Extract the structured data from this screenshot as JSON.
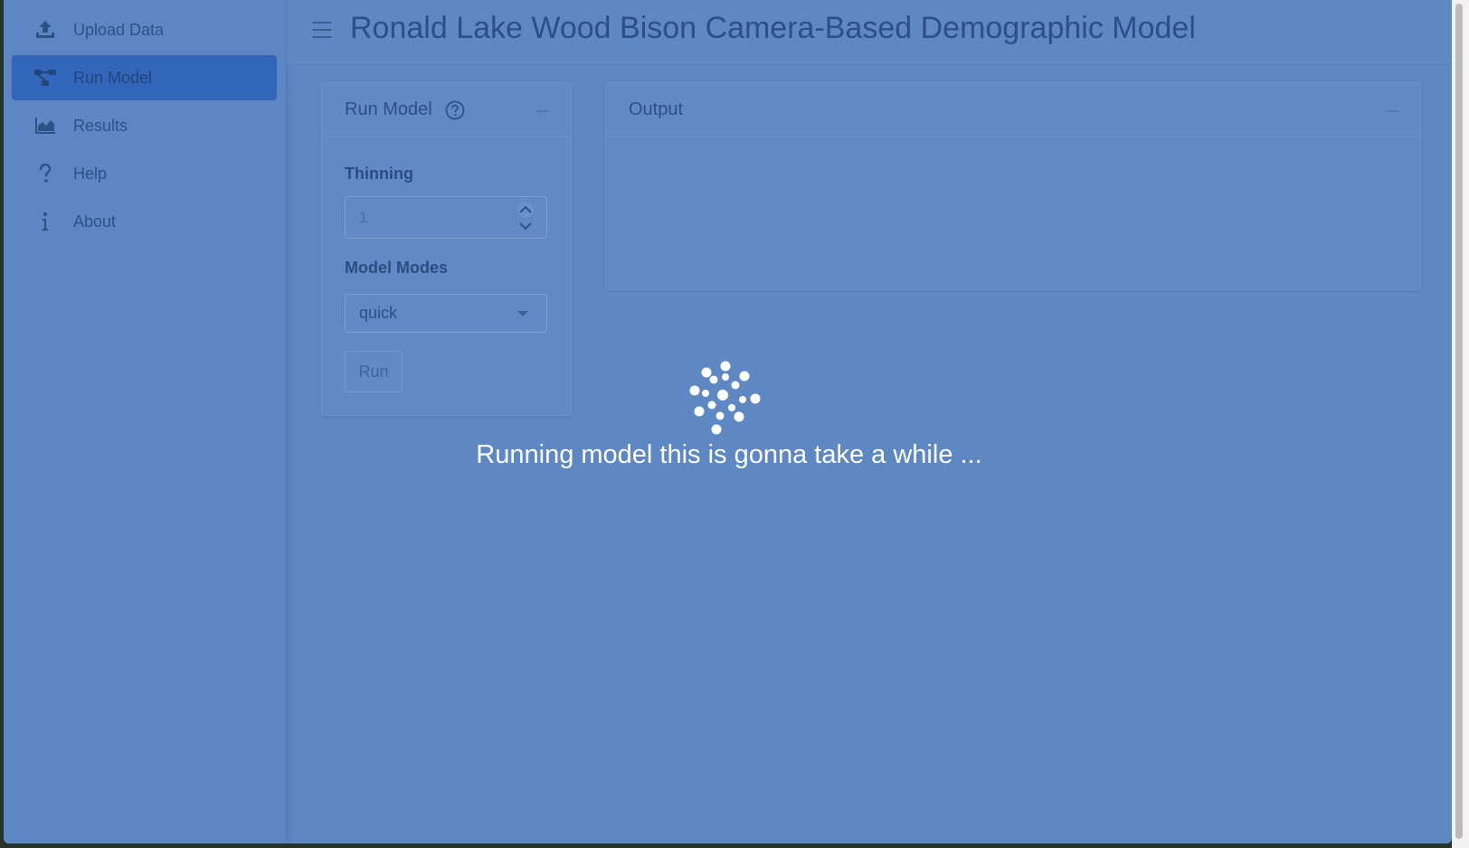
{
  "app": {
    "title": "Ronald Lake Wood Bison Camera-Based Demographic Model"
  },
  "sidebar": {
    "items": [
      {
        "label": "Upload Data",
        "icon": "upload-icon",
        "active": false
      },
      {
        "label": "Run Model",
        "icon": "project-diagram-icon",
        "active": true
      },
      {
        "label": "Results",
        "icon": "area-chart-icon",
        "active": false
      },
      {
        "label": "Help",
        "icon": "question-icon",
        "active": false
      },
      {
        "label": "About",
        "icon": "info-icon",
        "active": false
      }
    ]
  },
  "run_card": {
    "title": "Run Model",
    "help_icon": "question-circle-icon",
    "thinning": {
      "label": "Thinning",
      "value": "1"
    },
    "model_modes": {
      "label": "Model Modes",
      "selected": "quick"
    },
    "run_label": "Run"
  },
  "output_card": {
    "title": "Output"
  },
  "loading": {
    "message": "Running model this is gonna take a while ..."
  },
  "colors": {
    "background": "#5e88c4",
    "active_nav": "#3166bb",
    "text": "#2c4f85",
    "overlay_text": "#ffffff"
  }
}
